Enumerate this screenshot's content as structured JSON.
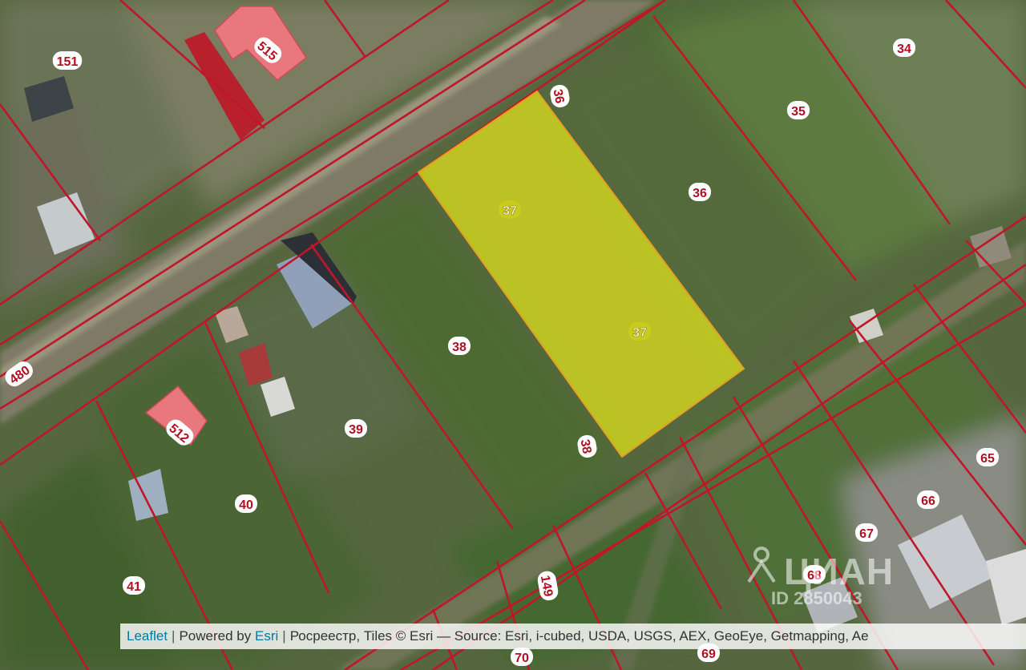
{
  "map": {
    "highlight_color": "#d8dc1e",
    "boundary_color": "#c0162a",
    "building_color": "#e8787e",
    "parcels": [
      {
        "label": "151"
      },
      {
        "label": "515"
      },
      {
        "label": "34"
      },
      {
        "label": "35"
      },
      {
        "label": "36"
      },
      {
        "label": "36"
      },
      {
        "label": "37"
      },
      {
        "label": "37"
      },
      {
        "label": "38"
      },
      {
        "label": "38"
      },
      {
        "label": "39"
      },
      {
        "label": "40"
      },
      {
        "label": "41"
      },
      {
        "label": "480"
      },
      {
        "label": "512"
      },
      {
        "label": "65"
      },
      {
        "label": "66"
      },
      {
        "label": "67"
      },
      {
        "label": "68"
      },
      {
        "label": "69"
      },
      {
        "label": "70"
      },
      {
        "label": "149"
      }
    ]
  },
  "attribution": {
    "leaflet": "Leaflet",
    "separator": "|",
    "powered_by": "Powered by",
    "esri": "Esri",
    "rest": "Росреестр, Tiles © Esri — Source: Esri, i-cubed, USDA, USGS, AEX, GeoEye, Getmapping, Ae"
  },
  "watermark": {
    "name": "ЦИАН",
    "id": "ID 2850043"
  }
}
